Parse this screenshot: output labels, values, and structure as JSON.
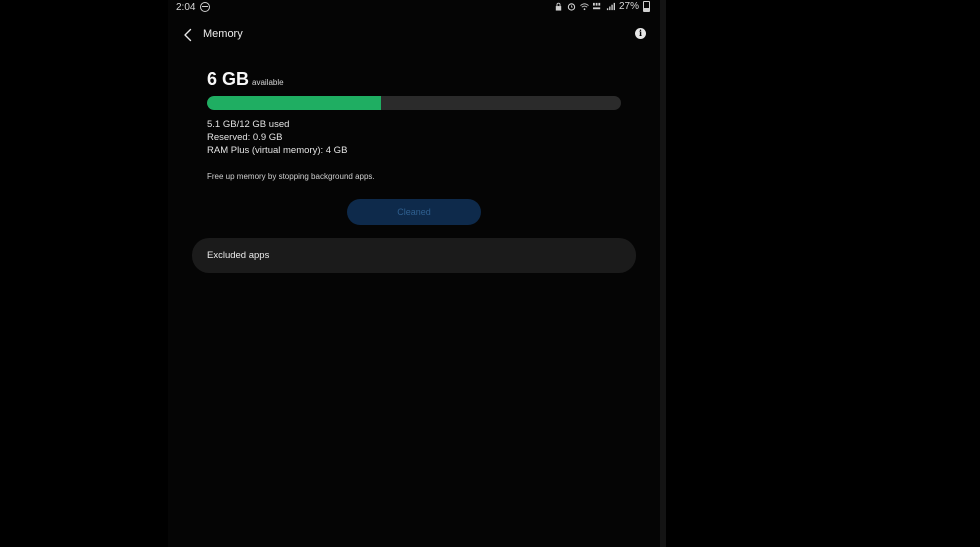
{
  "status_bar": {
    "time": "2:04",
    "battery": "27%",
    "icons": [
      "do-not-disturb-icon",
      "lock-icon",
      "alarm-icon",
      "wifi-icon",
      "volte-icon",
      "signal-icon",
      "battery-icon"
    ]
  },
  "header": {
    "title": "Memory",
    "back_icon": "chevron-left-icon",
    "info_icon": "info-icon"
  },
  "memory": {
    "available_value": "6 GB",
    "available_label": "available",
    "used_fraction": 0.42,
    "used_text": "5.1 GB/12 GB used",
    "reserved_text": "Reserved: 0.9 GB",
    "ram_plus_text": "RAM Plus (virtual memory): 4 GB",
    "tip": "Free up memory by stopping background apps."
  },
  "actions": {
    "cleaned_label": "Cleaned",
    "excluded_apps_label": "Excluded apps"
  },
  "colors": {
    "accent_green": "#1fae62",
    "button_bg": "#0e2a4b",
    "button_text": "#2f5f8f"
  }
}
